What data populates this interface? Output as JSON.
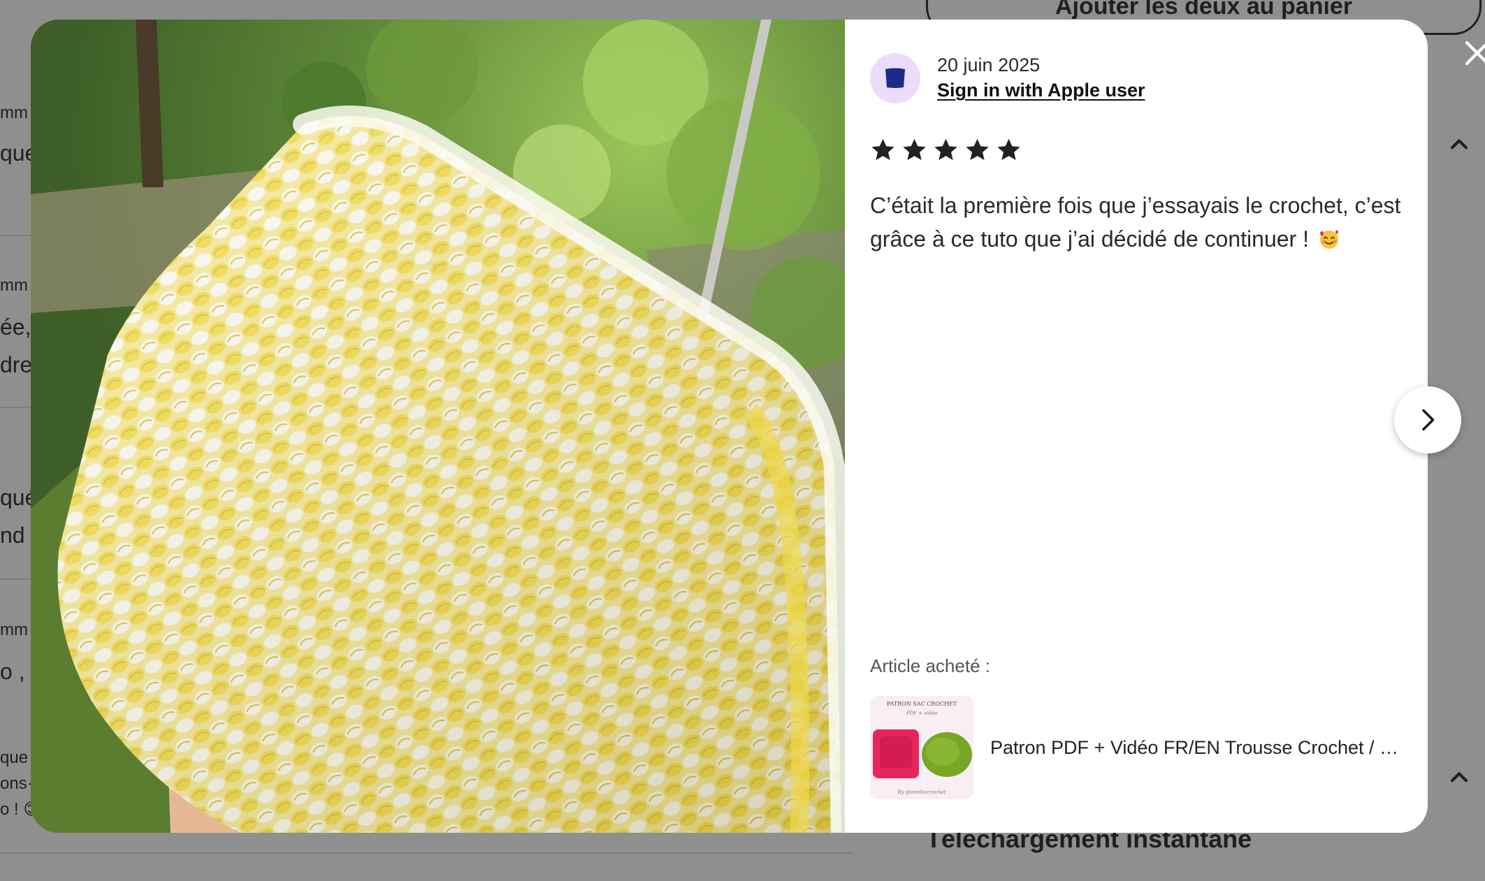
{
  "background": {
    "cart_button_label": "Ajouter les deux au panier",
    "section_heading": "Téléchargement instantané",
    "fragments": [
      "mm",
      "que",
      "mm",
      "ée,",
      "dre",
      "qué",
      "nd",
      "mm",
      "o ,",
      "que",
      "ons·",
      "o ! 😊"
    ]
  },
  "review": {
    "date": "20 juin 2025",
    "reviewer_name": "Sign in with Apple user",
    "rating": 5,
    "rating_max": 5,
    "text": "C’était la première fois que j’essayais le crochet, c’est grâce à ce tuto que j’ai décidé de continuer !",
    "text_emoji": "smiling-face-with-hearts-icon"
  },
  "purchase": {
    "label": "Article acheté :",
    "product_title": "Patron PDF + Vidéo FR/EN Trousse Crochet / Pochette crochet",
    "thumbnail": {
      "header": "PATRON SAC CROCHET",
      "subtitle": "PDF + vidéo",
      "footer": "By @annikacrochet"
    }
  },
  "controls": {
    "next_icon": "chevron-right-icon",
    "close_icon": "close-icon"
  },
  "colors": {
    "avatar_bg": "#ecdcfb",
    "avatar_fg": "#1c2a8a",
    "yarn_yellow": "#f2df5a",
    "yarn_white": "#fbfbf5",
    "foliage": "#4f7a33"
  }
}
